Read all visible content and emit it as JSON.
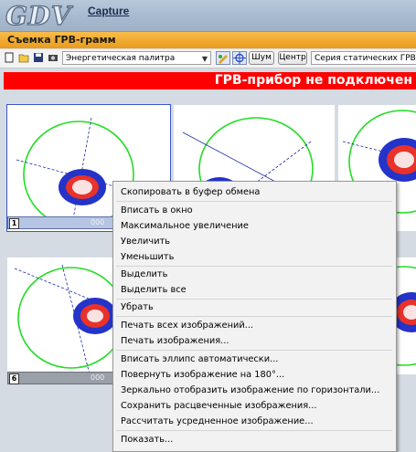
{
  "app": {
    "logo_text": "GDV",
    "capture_link": "Capture"
  },
  "window": {
    "title": "Съемка ГРВ-грамм"
  },
  "toolbar": {
    "icons": [
      "new-document-icon",
      "open-folder-icon",
      "save-icon",
      "camera-icon"
    ],
    "palette_select": "Энергетическая палитра",
    "noise_button": "Шум",
    "center_button": "Центр",
    "series_select": "Серия статических ГРВ-грамм"
  },
  "status": {
    "text": "ГРВ-прибор не подключен",
    "color": "#ff0000"
  },
  "cells": [
    {
      "number": "1",
      "value": "000"
    },
    {
      "number": "6",
      "value": "000"
    }
  ],
  "context_menu": {
    "items": [
      "Скопировать в буфер обмена",
      "Вписать в окно",
      "Максимальное увеличение",
      "Увеличить",
      "Уменьшить",
      "Выделить",
      "Выделить все",
      "Убрать",
      "Печать всех изображений...",
      "Печать изображения...",
      "Вписать эллипс автоматически...",
      "Повернуть изображение на 180°...",
      "Зеркально отобразить изображение по горизонтали...",
      "Сохранить расцвеченные изображения...",
      "Рассчитать усредненное изображение...",
      "Показать..."
    ]
  },
  "colors": {
    "accent_orange": "#f3a72b",
    "ellipse_green": "#22dd22",
    "glow_blue": "#2433c8",
    "glow_red": "#e8322a"
  }
}
